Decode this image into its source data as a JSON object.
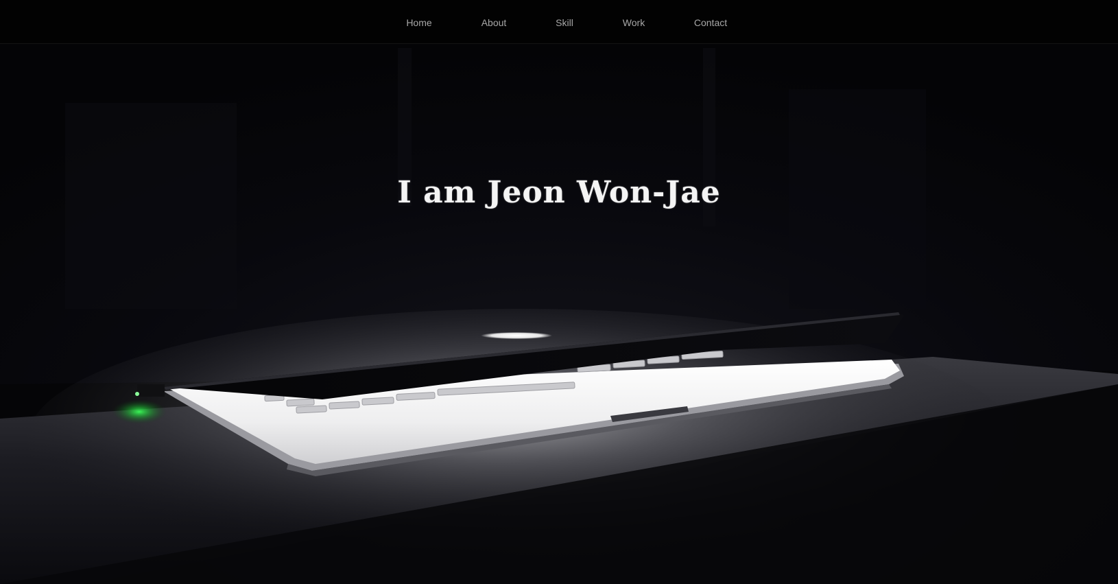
{
  "nav": {
    "items": [
      {
        "label": "Home"
      },
      {
        "label": "About"
      },
      {
        "label": "Skill"
      },
      {
        "label": "Work"
      },
      {
        "label": "Contact"
      }
    ]
  },
  "hero": {
    "title": "I am Jeon Won-Jae",
    "background_image": "laptop-glowing-in-dark-photo"
  },
  "colors": {
    "nav_background": "#020202",
    "nav_text": "#a8a8a8",
    "title_text": "#f4f4f4",
    "background": "#05050a",
    "led_green": "#22ff44"
  }
}
